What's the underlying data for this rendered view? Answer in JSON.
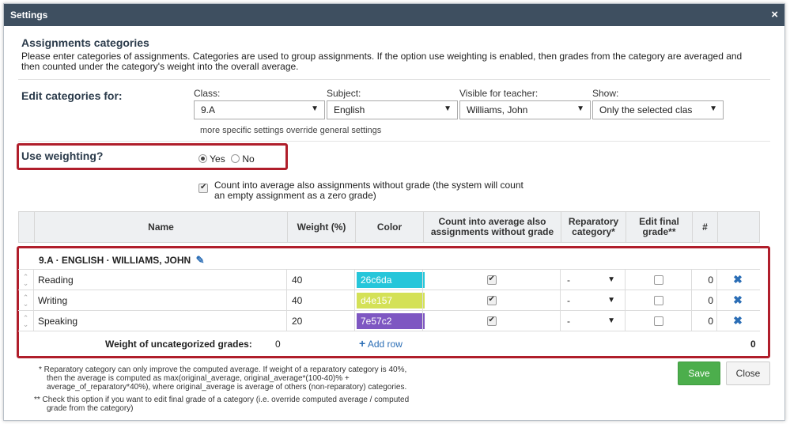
{
  "window": {
    "title": "Settings",
    "close_glyph": "×"
  },
  "section": {
    "heading": "Assignments categories",
    "description": "Please enter categories of assignments. Categories are used to group assignments. If the option use weighting is enabled, then grades from the category are averaged and then counted under the category's weight into the overall average."
  },
  "filters": {
    "heading": "Edit categories for:",
    "class_label": "Class:",
    "class_value": "9.A",
    "subject_label": "Subject:",
    "subject_value": "English",
    "teacher_label": "Visible for teacher:",
    "teacher_value": "Williams, John",
    "show_label": "Show:",
    "show_value": "Only the selected clas",
    "hint": "more specific settings override general settings",
    "arrow": "▼"
  },
  "weighting": {
    "label": "Use weighting?",
    "yes": "Yes",
    "no": "No",
    "selected": "Yes"
  },
  "count_option": {
    "checked": true,
    "text_line1": "Count into average also assignments without grade (the system will count",
    "text_line2": "an empty assignment as a zero grade)"
  },
  "table": {
    "headers": {
      "name": "Name",
      "weight": "Weight (%)",
      "color": "Color",
      "count_line1": "Count into average also",
      "count_line2": "assignments without grade",
      "reparatory_line1": "Reparatory",
      "reparatory_line2": "category*",
      "edit_final_line1": "Edit final",
      "edit_final_line2": "grade**",
      "hash": "#"
    },
    "group_title": "9.A · ENGLISH · WILLIAMS, JOHN",
    "rows": [
      {
        "name": "Reading",
        "weight": "40",
        "color": "26c6da",
        "count": true,
        "reparatory": "-",
        "edit_final": false,
        "count_num": "0"
      },
      {
        "name": "Writing",
        "weight": "40",
        "color": "d4e157",
        "count": true,
        "reparatory": "-",
        "edit_final": false,
        "count_num": "0"
      },
      {
        "name": "Speaking",
        "weight": "20",
        "color": "7e57c2",
        "count": true,
        "reparatory": "-",
        "edit_final": false,
        "count_num": "0"
      }
    ],
    "uncategorized_label": "Weight of uncategorized grades:",
    "uncategorized_value": "0",
    "add_row": "Add row",
    "total_count": "0"
  },
  "footnotes": {
    "note1_l1": "* Reparatory category can only improve the computed average. If weight of a reparatory category is 40%,",
    "note1_l2": "then the average is computed as max(original_average, original_average*(100-40)% +",
    "note1_l3": "average_of_reparatory*40%), where original_average is average of others (non-reparatory) categories.",
    "note2_l1": "** Check this option if you want to edit final grade of a category (i.e. override computed average / computed",
    "note2_l2": "grade from the category)"
  },
  "buttons": {
    "save": "Save",
    "close": "Close"
  },
  "colors": {
    "titlebar": "#3e4f60",
    "highlight": "#b01e2b",
    "save": "#4cae4c",
    "link": "#2a6db5",
    "swatch_reading": "#26c6da",
    "swatch_writing": "#d4e157",
    "swatch_speaking": "#7e57c2"
  },
  "icons": {
    "pencil": "pencil-icon",
    "delete": "delete-x-icon",
    "add": "plus-icon",
    "drag": "drag-handle-icon"
  }
}
